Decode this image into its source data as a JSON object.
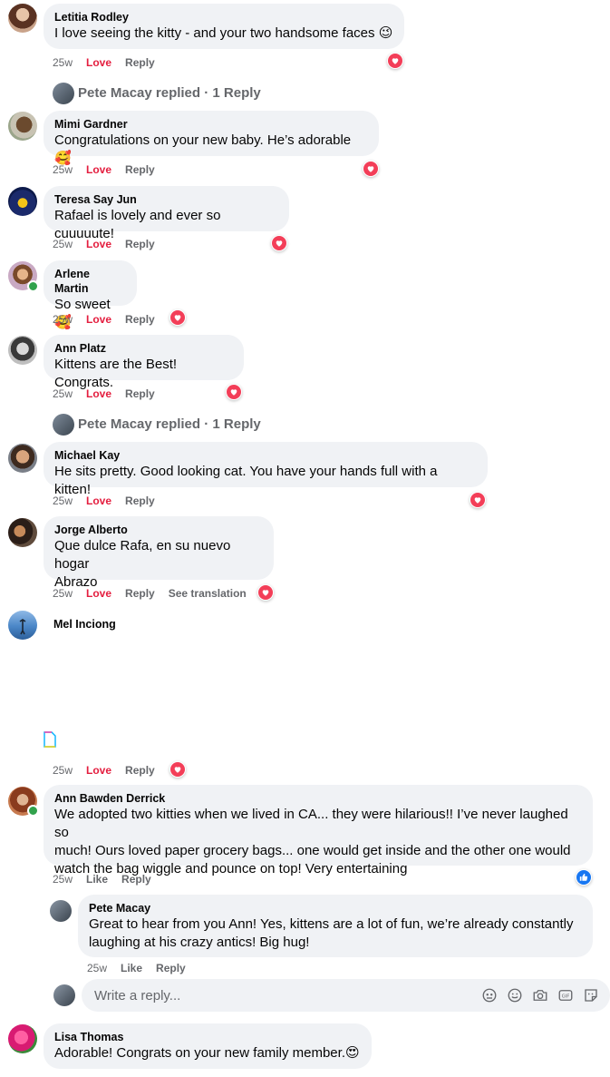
{
  "comments": [
    {
      "name": "Letitia Rodley",
      "text": "I love seeing the kitty - and your two handsome faces 😉",
      "time": "25w",
      "reaction_label": "Love",
      "reply": "Reply"
    },
    {
      "name": "Mimi Gardner",
      "text": "Congratulations on your new baby. He’s adorable 🥰",
      "time": "25w",
      "reaction_label": "Love",
      "reply": "Reply"
    },
    {
      "name": "Teresa Say Jun",
      "text": "Rafael is lovely and ever so cuuuuute!",
      "time": "25w",
      "reaction_label": "Love",
      "reply": "Reply"
    },
    {
      "name": "Arlene Martin",
      "text": "So sweet🥰",
      "time": "25w",
      "reaction_label": "Love",
      "reply": "Reply"
    },
    {
      "name": "Ann Platz",
      "text": "Kittens are the Best! Congrats.",
      "time": "25w",
      "reaction_label": "Love",
      "reply": "Reply"
    },
    {
      "name": "Michael Kay",
      "text": "He sits pretty. Good looking cat. You have your hands full with a kitten!",
      "time": "25w",
      "reaction_label": "Love",
      "reply": "Reply"
    },
    {
      "name": "Jorge Alberto",
      "text_line1": "Que dulce Rafa, en su nuevo hogar",
      "text_line2": "Abrazo",
      "time": "25w",
      "reaction_label": "Love",
      "reply": "Reply",
      "translate": "See translation"
    },
    {
      "name": "Mel Inciong",
      "time": "25w",
      "reaction_label": "Love",
      "reply": "Reply"
    },
    {
      "name": "Ann Bawden Derrick",
      "text_line1": "We adopted two kitties when we lived in CA... they were hilarious!! I’ve never laughed so",
      "text_line2": "much! Ours loved paper grocery bags... one would get inside and the other one would",
      "text_line3": "watch the bag wiggle and pounce on top! Very entertaining",
      "time": "25w",
      "reaction_label": "Like",
      "reply": "Reply"
    },
    {
      "name": "Lisa Thomas",
      "text": "Adorable! Congrats on your new family member.😍"
    }
  ],
  "replied_thread": {
    "text": "Pete Macay replied · 1 Reply"
  },
  "nested_reply": {
    "name": "Pete Macay",
    "text_line1": "Great to hear from you Ann! Yes, kittens are a lot of fun, we’re already constantly",
    "text_line2": "laughing at his crazy antics! Big hug!",
    "time": "25w",
    "reaction_label": "Like",
    "reply": "Reply"
  },
  "reply_box": {
    "placeholder": "Write a reply..."
  },
  "colors": {
    "bubble": "#f0f2f5",
    "love": "#e41e3f",
    "heart": "#f33e58",
    "like_blue": "#1877f2",
    "meta": "#65676b"
  },
  "icons": [
    "heart-icon",
    "thumbs-up-icon",
    "avatar-sticker-icon",
    "emoji-icon",
    "camera-icon",
    "gif-icon",
    "sticker-icon",
    "broken-image-icon"
  ]
}
